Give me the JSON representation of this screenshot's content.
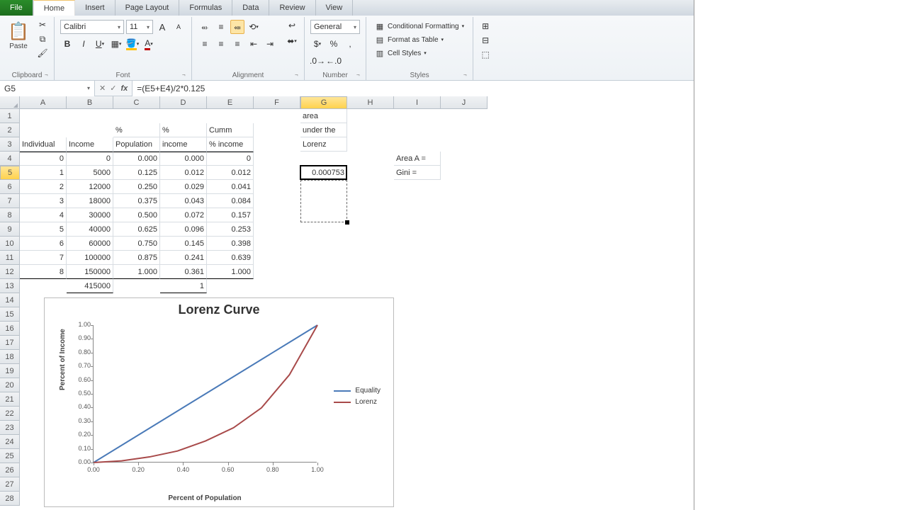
{
  "tabs": {
    "file": "File",
    "home": "Home",
    "insert": "Insert",
    "pagelayout": "Page Layout",
    "formulas": "Formulas",
    "data": "Data",
    "review": "Review",
    "view": "View"
  },
  "ribbon": {
    "clipboard": {
      "label": "Clipboard",
      "paste": "Paste"
    },
    "font": {
      "label": "Font",
      "name": "Calibri",
      "size": "11"
    },
    "alignment": {
      "label": "Alignment"
    },
    "number": {
      "label": "Number",
      "format": "General"
    },
    "styles": {
      "label": "Styles",
      "cond": "Conditional Formatting",
      "table": "Format as Table",
      "cell": "Cell Styles"
    }
  },
  "namebox": "G5",
  "formula": "=(E5+E4)/2*0.125",
  "cols": [
    "A",
    "B",
    "C",
    "D",
    "E",
    "F",
    "G",
    "H",
    "I",
    "J"
  ],
  "rows": [
    "1",
    "2",
    "3",
    "4",
    "5",
    "6",
    "7",
    "8",
    "9",
    "10",
    "11",
    "12",
    "13",
    "14",
    "15",
    "16",
    "17",
    "18",
    "19",
    "20",
    "21",
    "22",
    "23",
    "24",
    "25",
    "26",
    "27",
    "28"
  ],
  "cells": {
    "G1": "area",
    "G2": "under the",
    "G3": "Lorenz",
    "A3": "Individual",
    "B3": "Income",
    "C2": "%",
    "C3": "Population",
    "D2": "%",
    "D3": "income",
    "E2": "Cumm",
    "E3": "% income",
    "A4": "0",
    "B4": "0",
    "C4": "0.000",
    "D4": "0.000",
    "E4": "0",
    "A5": "1",
    "B5": "5000",
    "C5": "0.125",
    "D5": "0.012",
    "E5": "0.012",
    "G5": "0.000753",
    "A6": "2",
    "B6": "12000",
    "C6": "0.250",
    "D6": "0.029",
    "E6": "0.041",
    "A7": "3",
    "B7": "18000",
    "C7": "0.375",
    "D7": "0.043",
    "E7": "0.084",
    "A8": "4",
    "B8": "30000",
    "C8": "0.500",
    "D8": "0.072",
    "E8": "0.157",
    "A9": "5",
    "B9": "40000",
    "C9": "0.625",
    "D9": "0.096",
    "E9": "0.253",
    "A10": "6",
    "B10": "60000",
    "C10": "0.750",
    "D10": "0.145",
    "E10": "0.398",
    "A11": "7",
    "B11": "100000",
    "C11": "0.875",
    "D11": "0.241",
    "E11": "0.639",
    "A12": "8",
    "B12": "150000",
    "C12": "1.000",
    "D12": "0.361",
    "E12": "1.000",
    "B13": "415000",
    "D13": "1",
    "I4": "Area A =",
    "I5": "Gini ="
  },
  "chart_data": {
    "type": "line",
    "title": "Lorenz Curve",
    "xlabel": "Percent of Population",
    "ylabel": "Percent of Income",
    "xlim": [
      0,
      1
    ],
    "ylim": [
      0,
      1
    ],
    "xticks": [
      "0.00",
      "0.20",
      "0.40",
      "0.60",
      "0.80",
      "1.00"
    ],
    "yticks": [
      "0.00",
      "0.10",
      "0.20",
      "0.30",
      "0.40",
      "0.50",
      "0.60",
      "0.70",
      "0.80",
      "0.90",
      "1.00"
    ],
    "x": [
      0,
      0.125,
      0.25,
      0.375,
      0.5,
      0.625,
      0.75,
      0.875,
      1
    ],
    "series": [
      {
        "name": "Equality",
        "color": "#4a7ab8",
        "values": [
          0,
          0.125,
          0.25,
          0.375,
          0.5,
          0.625,
          0.75,
          0.875,
          1
        ]
      },
      {
        "name": "Lorenz",
        "color": "#a84a4a",
        "values": [
          0,
          0.012,
          0.041,
          0.084,
          0.157,
          0.253,
          0.398,
          0.639,
          1
        ]
      }
    ]
  }
}
